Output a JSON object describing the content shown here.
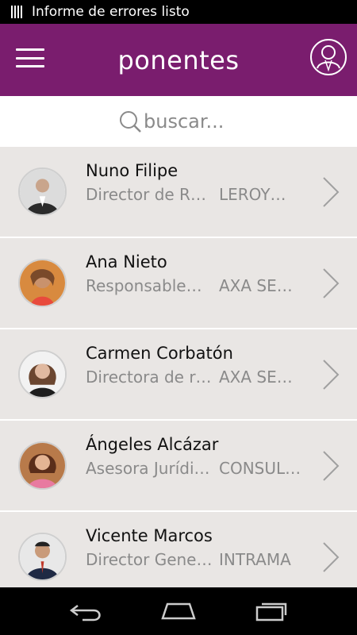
{
  "status_bar": {
    "notification": "Informe de errores listo"
  },
  "header": {
    "title": "ponentes"
  },
  "search": {
    "placeholder": "buscar..."
  },
  "speakers": [
    {
      "name": "Nuno Filipe",
      "role": "Director de R…",
      "company": "LEROY…"
    },
    {
      "name": "Ana Nieto",
      "role": "Responsable…",
      "company": "AXA SE…"
    },
    {
      "name": "Carmen Corbatón",
      "role": "Directora de r…",
      "company": "AXA SE…"
    },
    {
      "name": "Ángeles Alcázar",
      "role": "Asesora Jurídi…",
      "company": "CONSUL…"
    },
    {
      "name": "Vicente Marcos",
      "role": "Director General",
      "company": "INTRAMA"
    }
  ],
  "colors": {
    "header_bg": "#7a1d6e",
    "row_bg": "#e9e6e4",
    "secondary_text": "#8a8a8a"
  },
  "icons": [
    "menu-icon",
    "profile-icon",
    "search-icon",
    "chevron-right-icon",
    "back-icon",
    "home-icon",
    "recent-apps-icon"
  ]
}
